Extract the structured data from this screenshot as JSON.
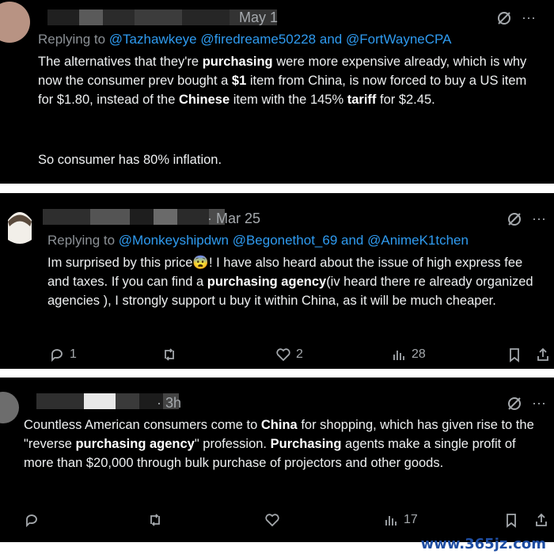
{
  "posts": [
    {
      "date": "May 1",
      "reply_prefix": "Replying to",
      "reply_handles": [
        "@Tazhawkeye",
        "@firedreame50228",
        "and",
        "@FortWayneCPA"
      ],
      "body": [
        {
          "t": "The alternatives that they're "
        },
        {
          "t": "purchasing",
          "b": true
        },
        {
          "t": " were more expensive already, which is why now the consumer prev bought a "
        },
        {
          "t": "$1",
          "b": true
        },
        {
          "t": " item from China, is now forced to buy a US item for $1.80, instead of the "
        },
        {
          "t": "Chinese",
          "b": true
        },
        {
          "t": " item with the 145% "
        },
        {
          "t": "tariff",
          "b": true
        },
        {
          "t": " for $2.45."
        }
      ],
      "body2": "So consumer has 80% inflation."
    },
    {
      "date": "· Mar 25",
      "reply_prefix": "Replying to",
      "reply_handles": [
        "@Monkeyshipdwn",
        "@Begonethot_69",
        "and",
        "@AnimeK1tchen"
      ],
      "body": [
        {
          "t": "Im surprised by this price😨! I have also heard about the issue of high express fee and taxes. If you can find a "
        },
        {
          "t": "purchasing agency",
          "b": true
        },
        {
          "t": "(iv heard there re already organized agencies ), I strongly support u buy it  within China, as it will be much cheaper."
        }
      ],
      "actions": {
        "replies": "1",
        "retweets": "",
        "likes": "2",
        "views": "28"
      }
    },
    {
      "date": "· 3h",
      "body": [
        {
          "t": "Countless American consumers come to "
        },
        {
          "t": "China",
          "b": true
        },
        {
          "t": " for shopping, which has given rise to the \"reverse "
        },
        {
          "t": "purchasing agency",
          "b": true
        },
        {
          "t": "\" profession. "
        },
        {
          "t": "Purchasing",
          "b": true
        },
        {
          "t": " agents make a single profit of more than $20,000 through bulk purchase of projectors and other goods."
        }
      ],
      "actions": {
        "replies": "",
        "retweets": "",
        "likes": "",
        "views": "17"
      }
    }
  ],
  "more_label": "···",
  "watermark": "www.365jz.com"
}
